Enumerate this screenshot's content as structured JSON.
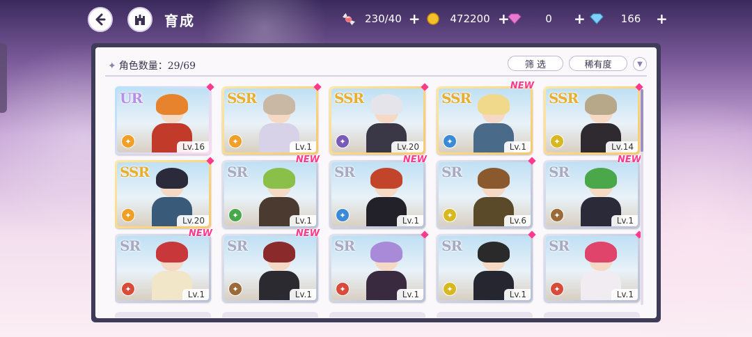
{
  "header": {
    "title": "育成"
  },
  "resources": [
    {
      "icon": "candy-icon",
      "value": "230/40"
    },
    {
      "icon": "gold-coin-icon",
      "value": "472200"
    },
    {
      "icon": "pink-diamond-icon",
      "value": "0"
    },
    {
      "icon": "blue-diamond-icon",
      "value": "166"
    }
  ],
  "panel": {
    "count_label": "角色数量：29/69",
    "filter_label": "筛 选",
    "rarity_label": "稀有度"
  },
  "cards": [
    {
      "rank": "UR",
      "level": "Lv.16",
      "new": false,
      "cls": "orange-class",
      "hair": "#e6832c",
      "outfit": "#c23a2a"
    },
    {
      "rank": "SSR",
      "level": "Lv.1",
      "new": false,
      "cls": "orange-class",
      "hair": "#c9b9a4",
      "outfit": "#d8d2e8"
    },
    {
      "rank": "SSR",
      "level": "Lv.20",
      "new": false,
      "cls": "purple-class",
      "hair": "#e4e4ea",
      "outfit": "#3a3846"
    },
    {
      "rank": "SSR",
      "level": "Lv.1",
      "new": true,
      "cls": "blue-class",
      "hair": "#f1d98c",
      "outfit": "#4a6a8a"
    },
    {
      "rank": "SSR",
      "level": "Lv.14",
      "new": false,
      "cls": "yellow-class",
      "hair": "#b8a88a",
      "outfit": "#2e2a30"
    },
    {
      "rank": "SSR",
      "level": "Lv.20",
      "new": false,
      "cls": "orange-class",
      "hair": "#2a2a3a",
      "outfit": "#3a5a7a"
    },
    {
      "rank": "SR",
      "level": "Lv.1",
      "new": true,
      "cls": "green-class",
      "hair": "#8ac04a",
      "outfit": "#4a3a30"
    },
    {
      "rank": "SR",
      "level": "Lv.1",
      "new": true,
      "cls": "blue-class",
      "hair": "#c2442a",
      "outfit": "#222028"
    },
    {
      "rank": "SR",
      "level": "Lv.6",
      "new": false,
      "cls": "yellow-class",
      "hair": "#8a5a2e",
      "outfit": "#5a4a2a"
    },
    {
      "rank": "SR",
      "level": "Lv.1",
      "new": true,
      "cls": "brown-class",
      "hair": "#4aa84a",
      "outfit": "#2a2a38"
    },
    {
      "rank": "SR",
      "level": "Lv.1",
      "new": true,
      "cls": "red-class",
      "hair": "#c8383a",
      "outfit": "#f2e6c8"
    },
    {
      "rank": "SR",
      "level": "Lv.1",
      "new": true,
      "cls": "brown-class",
      "hair": "#8a2a2a",
      "outfit": "#2a2a30"
    },
    {
      "rank": "SR",
      "level": "Lv.1",
      "new": false,
      "cls": "red-class",
      "hair": "#a88ad8",
      "outfit": "#3a2a40"
    },
    {
      "rank": "SR",
      "level": "Lv.1",
      "new": false,
      "cls": "yellow-class",
      "hair": "#2a2a2a",
      "outfit": "#262630"
    },
    {
      "rank": "SR",
      "level": "Lv.1",
      "new": false,
      "cls": "red-class",
      "hair": "#e0446a",
      "outfit": "#f0ecf2"
    }
  ],
  "colors": {
    "orange-class": "#f0a028",
    "purple-class": "#7a5ab8",
    "blue-class": "#3a8ad8",
    "yellow-class": "#d8b820",
    "green-class": "#48a84a",
    "brown-class": "#9a6a3a",
    "red-class": "#d84a3a"
  },
  "new_label": "NEW"
}
